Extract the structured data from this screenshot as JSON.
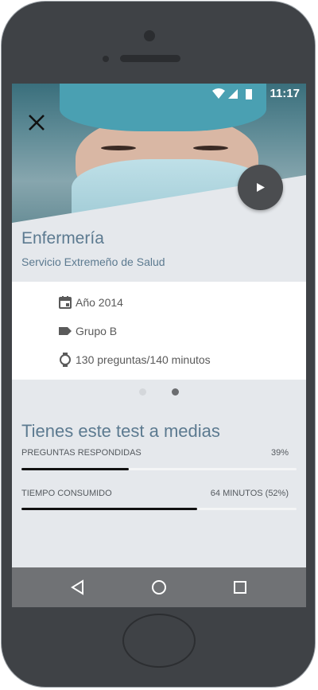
{
  "status_bar": {
    "time": "11:17"
  },
  "header": {
    "close_icon": "close-icon",
    "play_icon": "play-icon"
  },
  "exam": {
    "title": "Enfermería",
    "organization": "Servicio Extremeño de Salud"
  },
  "details": [
    {
      "icon": "calendar-icon",
      "text": "Año 2014"
    },
    {
      "icon": "tag-icon",
      "text": "Grupo B"
    },
    {
      "icon": "watch-icon",
      "text": "130 preguntas/140 minutos"
    }
  ],
  "pager": {
    "count": 2,
    "active_index": 1
  },
  "progress": {
    "heading": "Tienes este test a medias",
    "answered": {
      "label": "PREGUNTAS RESPONDIDAS",
      "value": "39%",
      "fraction": 0.39
    },
    "time": {
      "label": "TIEMPO CONSUMIDO",
      "value": "64 MINUTOS (52%)",
      "fraction": 0.64
    }
  },
  "navigation": {
    "back_icon": "back-icon",
    "home_icon": "home-icon",
    "recents_icon": "recents-icon"
  },
  "colors": {
    "accent": "#5c7a90",
    "nav_bar": "#707275",
    "fab": "#4b4d50"
  }
}
